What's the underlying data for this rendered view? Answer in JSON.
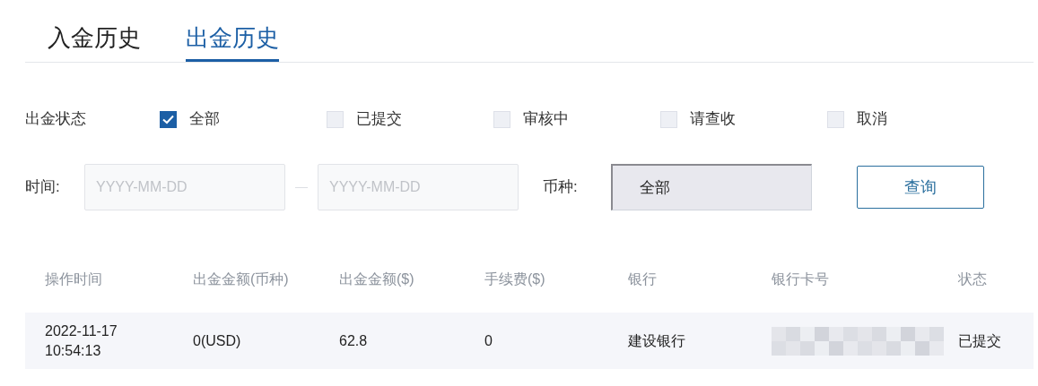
{
  "tabs": [
    {
      "label": "入金历史",
      "selected": false
    },
    {
      "label": "出金历史",
      "selected": true
    }
  ],
  "status_filter": {
    "label": "出金状态",
    "options": [
      {
        "label": "全部",
        "checked": true
      },
      {
        "label": "已提交",
        "checked": false
      },
      {
        "label": "审核中",
        "checked": false
      },
      {
        "label": "请查收",
        "checked": false
      },
      {
        "label": "取消",
        "checked": false
      }
    ]
  },
  "date_filter": {
    "label": "时间:",
    "from": {
      "placeholder": "YYYY-MM-DD"
    },
    "to": {
      "placeholder": "YYYY-MM-DD"
    }
  },
  "currency_filter": {
    "label": "币种:",
    "value": "全部"
  },
  "query_button": "查询",
  "table": {
    "columns": [
      "操作时间",
      "出金金额(币种)",
      "出金金额($)",
      "手续费($)",
      "银行",
      "银行卡号",
      "状态"
    ],
    "rows": [
      {
        "cells": [
          {
            "kind": "text",
            "lines": [
              "2022-11-17",
              "10:54:13"
            ]
          },
          {
            "kind": "text",
            "lines": [
              "0(USD)"
            ]
          },
          {
            "kind": "text",
            "lines": [
              "62.8"
            ]
          },
          {
            "kind": "text",
            "lines": [
              "0"
            ]
          },
          {
            "kind": "text",
            "lines": [
              "建设银行"
            ]
          },
          {
            "kind": "redacted"
          },
          {
            "kind": "text",
            "lines": [
              "已提交"
            ]
          }
        ]
      }
    ]
  }
}
